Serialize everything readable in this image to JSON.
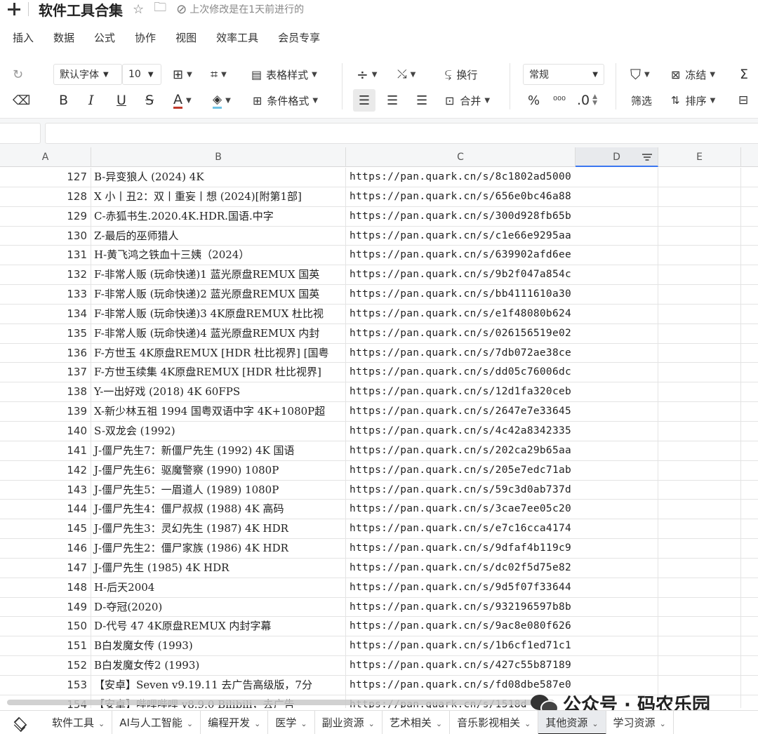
{
  "titlebar": {
    "title": "软件工具合集",
    "saved": "上次修改是在1天前进行的"
  },
  "menu": [
    "插入",
    "数据",
    "公式",
    "协作",
    "视图",
    "效率工具",
    "会员专享"
  ],
  "toolbar": {
    "font_name": "默认字体",
    "font_size": "10",
    "table_style": "表格样式",
    "conditional_format": "条件格式",
    "wrap": "换行",
    "merge": "合并",
    "number_format": "常规",
    "percent": "%",
    "thousands": "⁰⁰⁰",
    "decimal": ".0",
    "filter": "筛选",
    "freeze": "冻结",
    "sort": "排序",
    "bold": "B",
    "italic": "I",
    "underline": "U",
    "strike": "S",
    "font_color": "A",
    "sigma": "Σ"
  },
  "columns": [
    "A",
    "B",
    "C",
    "D",
    "E"
  ],
  "rows": [
    {
      "n": "127",
      "b": "B-异变狼人 (2024) 4K",
      "c": "https://pan.quark.cn/s/8c1802ad5000"
    },
    {
      "n": "128",
      "b": "X 小丨丑2：双丨重妄丨想 (2024)[附第1部]",
      "c": "https://pan.quark.cn/s/656e0bc46a88"
    },
    {
      "n": "129",
      "b": "C-赤狐书生.2020.4K.HDR.国语.中字",
      "c": "https://pan.quark.cn/s/300d928fb65b"
    },
    {
      "n": "130",
      "b": "Z-最后的巫师猎人",
      "c": "https://pan.quark.cn/s/c1e66e9295aa"
    },
    {
      "n": "131",
      "b": "H-黄飞鸿之铁血十三姨（2024）",
      "c": "https://pan.quark.cn/s/639902afd6ee"
    },
    {
      "n": "132",
      "b": "F-非常人贩 (玩命快递)1 蓝光原盘REMUX 国英",
      "c": "https://pan.quark.cn/s/9b2f047a854c"
    },
    {
      "n": "133",
      "b": "F-非常人贩 (玩命快递)2 蓝光原盘REMUX 国英",
      "c": "https://pan.quark.cn/s/bb4111610a30"
    },
    {
      "n": "134",
      "b": "F-非常人贩 (玩命快递)3 4K原盘REMUX 杜比视",
      "c": "https://pan.quark.cn/s/e1f48080b624"
    },
    {
      "n": "135",
      "b": "F-非常人贩 (玩命快递)4 蓝光原盘REMUX 内封",
      "c": "https://pan.quark.cn/s/026156519e02"
    },
    {
      "n": "136",
      "b": "F-方世玉 4K原盘REMUX [HDR 杜比视界] [国粤",
      "c": "https://pan.quark.cn/s/7db072ae38ce"
    },
    {
      "n": "137",
      "b": "F-方世玉续集 4K原盘REMUX [HDR 杜比视界]",
      "c": "https://pan.quark.cn/s/dd05c76006dc"
    },
    {
      "n": "138",
      "b": "Y-一出好戏 (2018) 4K 60FPS",
      "c": "https://pan.quark.cn/s/12d1fa320ceb"
    },
    {
      "n": "139",
      "b": "X-新少林五祖 1994 国粤双语中字 4K+1080P超",
      "c": "https://pan.quark.cn/s/2647e7e33645"
    },
    {
      "n": "140",
      "b": "S-双龙会 (1992)",
      "c": "https://pan.quark.cn/s/4c42a8342335"
    },
    {
      "n": "141",
      "b": "J-僵尸先生7：新僵尸先生 (1992) 4K 国语",
      "c": "https://pan.quark.cn/s/202ca29b65aa"
    },
    {
      "n": "142",
      "b": "J-僵尸先生6：驱魔警察 (1990) 1080P",
      "c": "https://pan.quark.cn/s/205e7edc71ab"
    },
    {
      "n": "143",
      "b": "J-僵尸先生5：一眉道人 (1989) 1080P",
      "c": "https://pan.quark.cn/s/59c3d0ab737d"
    },
    {
      "n": "144",
      "b": "J-僵尸先生4：僵尸叔叔 (1988) 4K 高码",
      "c": "https://pan.quark.cn/s/3cae7ee05c20"
    },
    {
      "n": "145",
      "b": "J-僵尸先生3：灵幻先生 (1987) 4K HDR",
      "c": "https://pan.quark.cn/s/e7c16cca4174"
    },
    {
      "n": "146",
      "b": "J-僵尸先生2：僵尸家族 (1986) 4K HDR",
      "c": "https://pan.quark.cn/s/9dfaf4b119c9"
    },
    {
      "n": "147",
      "b": "J-僵尸先生 (1985) 4K HDR",
      "c": "https://pan.quark.cn/s/dc02f5d75e82"
    },
    {
      "n": "148",
      "b": "H-后天2004",
      "c": "https://pan.quark.cn/s/9d5f07f33644"
    },
    {
      "n": "149",
      "b": "D-夺冠(2020)",
      "c": "https://pan.quark.cn/s/932196597b8b"
    },
    {
      "n": "150",
      "b": "D-代号 47 4K原盘REMUX 内封字幕",
      "c": "https://pan.quark.cn/s/9ac8e080f626"
    },
    {
      "n": "151",
      "b": "B白发魔女传 (1993)",
      "c": "https://pan.quark.cn/s/1b6cf1ed71c1"
    },
    {
      "n": "152",
      "b": "B白发魔女传2 (1993)",
      "c": "https://pan.quark.cn/s/427c55b87189"
    },
    {
      "n": "153",
      "b": "【安卓】Seven v9.19.11 去广告高级版，7分",
      "c": "https://pan.quark.cn/s/fd08dbe587e0"
    },
    {
      "n": "154",
      "b": "【安卓】哔哩哔哩 v8.9.0 Bilibili，去广告",
      "c": "https://pan.quark.cn/s/1518d"
    }
  ],
  "watermark": "公众号 · 码农乐园",
  "sheets": [
    {
      "label": "软件工具",
      "active": false
    },
    {
      "label": "AI与人工智能",
      "active": false
    },
    {
      "label": "编程开发",
      "active": false
    },
    {
      "label": "医学",
      "active": false
    },
    {
      "label": "副业资源",
      "active": false
    },
    {
      "label": "艺术相关",
      "active": false
    },
    {
      "label": "音乐影视相关",
      "active": false
    },
    {
      "label": "其他资源",
      "active": true
    },
    {
      "label": "学习资源",
      "active": false
    }
  ]
}
